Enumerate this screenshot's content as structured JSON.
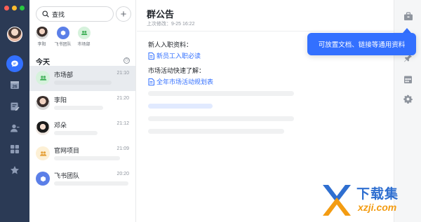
{
  "window": {
    "traffic_lights": [
      "#ff5f57",
      "#febc2e",
      "#28c840"
    ]
  },
  "rail": {
    "items": [
      {
        "icon": "chat-icon",
        "active": true
      },
      {
        "icon": "calendar-icon",
        "label": "26"
      },
      {
        "icon": "edit-doc-icon"
      },
      {
        "icon": "contacts-icon"
      },
      {
        "icon": "apps-icon"
      },
      {
        "icon": "star-icon"
      }
    ]
  },
  "search": {
    "placeholder": "查找"
  },
  "pinned": [
    {
      "label": "李阳",
      "icon": "user-avatar"
    },
    {
      "label": "飞书团队",
      "icon": "team-icon"
    },
    {
      "label": "市场部",
      "icon": "group-icon"
    }
  ],
  "list": {
    "section_title": "今天",
    "conversations": [
      {
        "name": "市场部",
        "time": "21:10",
        "icon": "group-icon"
      },
      {
        "name": "李阳",
        "time": "21:20",
        "icon": "user-avatar"
      },
      {
        "name": "邓朵",
        "time": "21:12",
        "icon": "user-avatar"
      },
      {
        "name": "官网项目",
        "time": "21:09",
        "icon": "group-icon"
      },
      {
        "name": "飞书团队",
        "time": "20:20",
        "icon": "team-icon"
      }
    ]
  },
  "announcement": {
    "title": "群公告",
    "last_modified": "上次修改：9-25 16:22",
    "section1_text": "新人入职资料：",
    "section1_link": "新员工入职必读",
    "section2_text": "市场活动快速了解：",
    "section2_link": "全年市场活动规划表"
  },
  "toolbar": {
    "items": [
      "briefcase-icon",
      "pin-icon",
      "calendar-grid-icon",
      "settings-icon"
    ]
  },
  "tooltip": {
    "text": "可放置文档、链接等通用资料"
  },
  "watermark": {
    "title": "下载集",
    "url": "xzji.com"
  },
  "colors": {
    "accent": "#3370ff",
    "rail_bg": "#2b3a55",
    "tooltip_bg": "#3370ff"
  }
}
